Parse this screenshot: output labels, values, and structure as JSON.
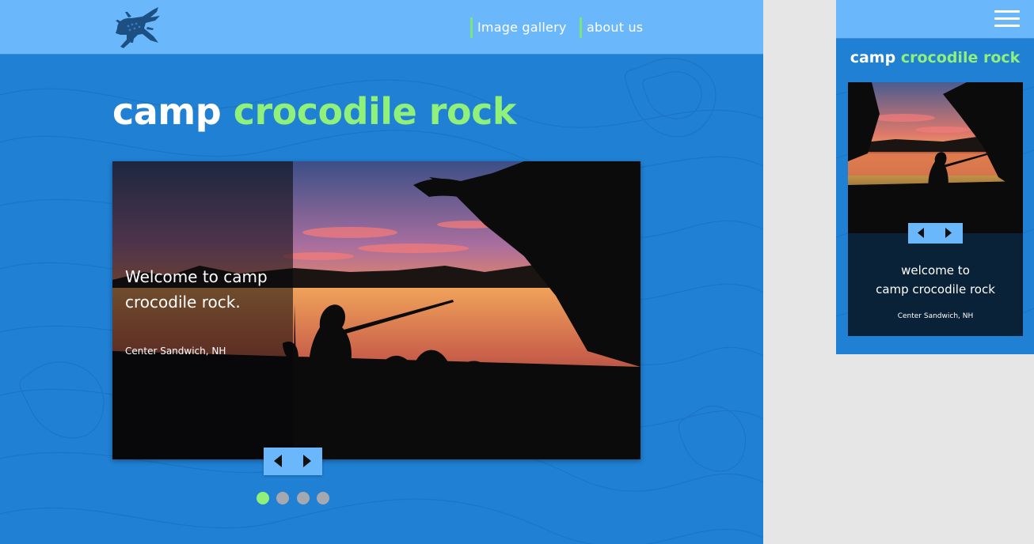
{
  "desktop": {
    "nav": {
      "gallery_label": "Image gallery",
      "about_label": "about us"
    },
    "title": {
      "word1": "camp",
      "word2": "crocodile rock"
    },
    "hero": {
      "welcome_text": "Welcome to camp crocodile rock.",
      "location": "Center Sandwich, NH"
    },
    "carousel": {
      "slide_count": 4,
      "active_index": 0
    }
  },
  "mobile": {
    "title": {
      "word1": "camp",
      "word2": "crocodile rock"
    },
    "welcome_line1": "welcome to",
    "welcome_line2": "camp crocodile rock",
    "location": "Center Sandwich, NH"
  },
  "icons": {
    "logo": "crocodile-icon",
    "menu": "hamburger-menu-icon",
    "prev": "caret-left-icon",
    "next": "caret-right-icon"
  },
  "colors": {
    "page_blue": "#2080d4",
    "header_blue": "#6ab8fb",
    "accent_green": "#8ff07a",
    "dot_inactive": "#a6a8b0",
    "outer_gray": "#e6e6e6"
  }
}
